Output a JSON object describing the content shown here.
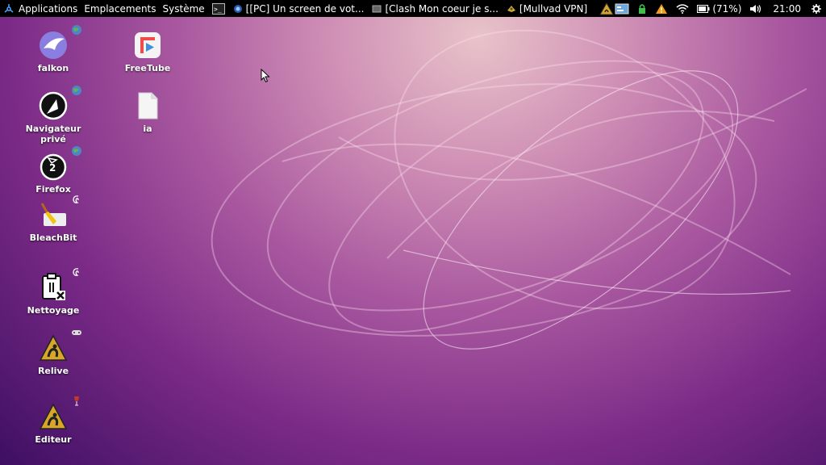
{
  "panel": {
    "menus": [
      "Applications",
      "Emplacements",
      "Système"
    ],
    "tasks": [
      {
        "icon": "terminal-icon",
        "label": ""
      },
      {
        "icon": "browser-icon",
        "label": "[[PC] Un screen de vot..."
      },
      {
        "icon": "window-icon",
        "label": "[Clash Mon coeur je s..."
      },
      {
        "icon": "vpn-icon",
        "label": "[Mullvad VPN]"
      }
    ],
    "tray": {
      "battery": "(71%)",
      "clock": "21:00"
    }
  },
  "desktop": {
    "icons": [
      {
        "label": "falkon",
        "icon": "falkon-icon",
        "emblem": "globe"
      },
      {
        "label": "Navigateur privé",
        "icon": "private-browser-icon",
        "emblem": "globe"
      },
      {
        "label": "Firefox",
        "icon": "firefox-icon",
        "emblem": "globe"
      },
      {
        "label": "BleachBit",
        "icon": "bleachbit-icon",
        "emblem": "debian"
      },
      {
        "label": "Nettoyage",
        "icon": "cleanup-icon",
        "emblem": "debian"
      },
      {
        "label": "Relive",
        "icon": "relive-icon",
        "emblem": "gamepad"
      },
      {
        "label": "Editeur",
        "icon": "editor-icon",
        "emblem": "wine"
      },
      {
        "label": "FreeTube",
        "icon": "freetube-icon",
        "emblem": ""
      },
      {
        "label": "ia",
        "icon": "file-icon",
        "emblem": ""
      }
    ]
  },
  "colors": {
    "panel_bg": "#000000",
    "wallpaper_top": "#e8c3c9",
    "wallpaper_bottom": "#3d0f63"
  }
}
